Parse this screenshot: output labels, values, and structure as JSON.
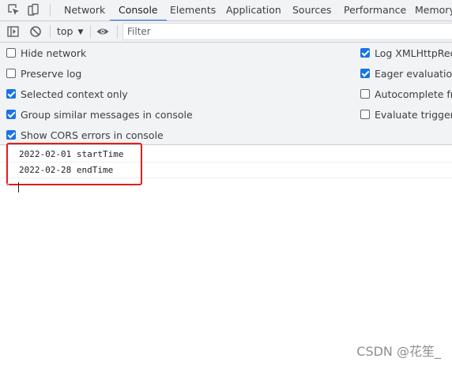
{
  "tabbar": {
    "inspect_icon": "inspect-element-icon",
    "device_icon": "device-toolbar-icon",
    "tabs": [
      {
        "label": "Network",
        "active": false
      },
      {
        "label": "Console",
        "active": true
      },
      {
        "label": "Elements",
        "active": false
      },
      {
        "label": "Application",
        "active": false
      },
      {
        "label": "Sources",
        "active": false
      },
      {
        "label": "Performance",
        "active": false
      },
      {
        "label": "Memory",
        "active": false
      }
    ],
    "accent_color": "#1a73e8"
  },
  "toolbar": {
    "sidebar_icon": "show-sidebar-icon",
    "clear_icon": "clear-console-icon",
    "context": "top",
    "eye_icon": "live-expression-eye-icon",
    "filter": {
      "placeholder": "Filter",
      "value": ""
    }
  },
  "settings": {
    "left": [
      {
        "label": "Hide network",
        "checked": false
      },
      {
        "label": "Preserve log",
        "checked": false
      },
      {
        "label": "Selected context only",
        "checked": true
      },
      {
        "label": "Group similar messages in console",
        "checked": true
      },
      {
        "label": "Show CORS errors in console",
        "checked": true
      }
    ],
    "right": [
      {
        "label": "Log XMLHttpRequests",
        "checked": true
      },
      {
        "label": "Eager evaluation",
        "checked": true
      },
      {
        "label": "Autocomplete from history",
        "checked": false
      },
      {
        "label": "Evaluate triggers user activation",
        "checked": false
      }
    ]
  },
  "console": {
    "messages": [
      {
        "text": "2022-02-01 startTime"
      },
      {
        "text": "2022-02-28 endTime"
      }
    ],
    "highlight_color": "#e0201b"
  },
  "watermark": "CSDN @花笙_"
}
